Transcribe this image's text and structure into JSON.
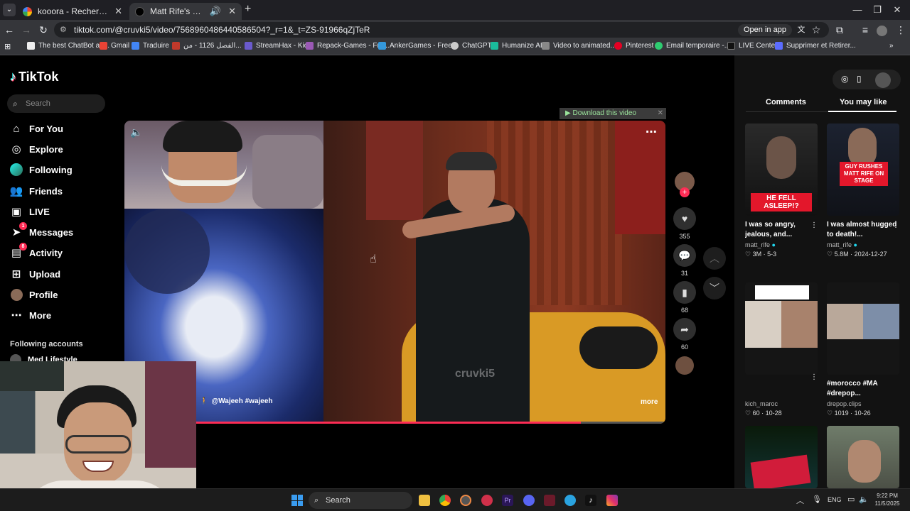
{
  "browser": {
    "tabs": [
      {
        "title": "kooora - Recherche Google",
        "active": false
      },
      {
        "title": "Matt Rife's Hilarious Stand",
        "active": true
      }
    ],
    "new_tab": "+",
    "url": "tiktok.com/@cruvki5/video/7568960486440586504?_r=1&_t=ZS-91966qZjTeR",
    "open_in_app": "Open in app",
    "bookmarks": [
      "The best ChatBot an...",
      "Gmail",
      "Traduire",
      "الفصل 1126 - من...",
      "StreamHax - Kick",
      "Repack-Games - Fre...",
      "AnkerGames - Free...",
      "ChatGPT",
      "Humanize AI",
      "Video to animated...",
      "Pinterest",
      "Email temporaire -...",
      "LIVE Center",
      "Supprimer et Retirer..."
    ]
  },
  "sidebar": {
    "logo": "TikTok",
    "search_placeholder": "Search",
    "items": [
      {
        "label": "For You",
        "icon": "home-icon"
      },
      {
        "label": "Explore",
        "icon": "compass-icon"
      },
      {
        "label": "Following",
        "icon": "following-icon"
      },
      {
        "label": "Friends",
        "icon": "friends-icon"
      },
      {
        "label": "LIVE",
        "icon": "live-icon"
      },
      {
        "label": "Messages",
        "icon": "messages-icon",
        "badge": "1"
      },
      {
        "label": "Activity",
        "icon": "activity-icon",
        "badge": "8"
      },
      {
        "label": "Upload",
        "icon": "upload-icon"
      },
      {
        "label": "Profile",
        "icon": "profile-icon"
      },
      {
        "label": "More",
        "icon": "more-icon"
      }
    ],
    "following_header": "Following accounts",
    "following_first": "Med Lifestyle"
  },
  "video": {
    "download_bar": "Download this video",
    "watermark": "cruvki5",
    "caption_tags": "@Wajeeh  #wajeeh",
    "more": "more"
  },
  "actions": {
    "likes": "355",
    "comments": "31",
    "saves": "68",
    "shares": "60"
  },
  "panel": {
    "tab_comments": "Comments",
    "tab_you_may_like": "You may like",
    "cards": [
      {
        "overlay": "HE FELL ASLEEP!?",
        "title": "I was so angry, jealous, and...",
        "author": "matt_rife",
        "views": "3M",
        "date": "5-3"
      },
      {
        "overlay": "GUY RUSHES MATT RIFE ON STAGE",
        "title": "I was almost hugged to death!...",
        "author": "matt_rife",
        "views": "5.8M",
        "date": "2024-12-27"
      },
      {
        "overlay": "",
        "title": "",
        "author": "kich_maroc",
        "views": "60",
        "date": "10-28"
      },
      {
        "overlay": "",
        "title": "#morocco #MA #drepop...",
        "author": "drepop.clips",
        "views": "1019",
        "date": "10-26"
      }
    ]
  },
  "taskbar": {
    "search": "Search",
    "lang": "ENG",
    "time": "9:22 PM",
    "date": "11/5/2025"
  }
}
